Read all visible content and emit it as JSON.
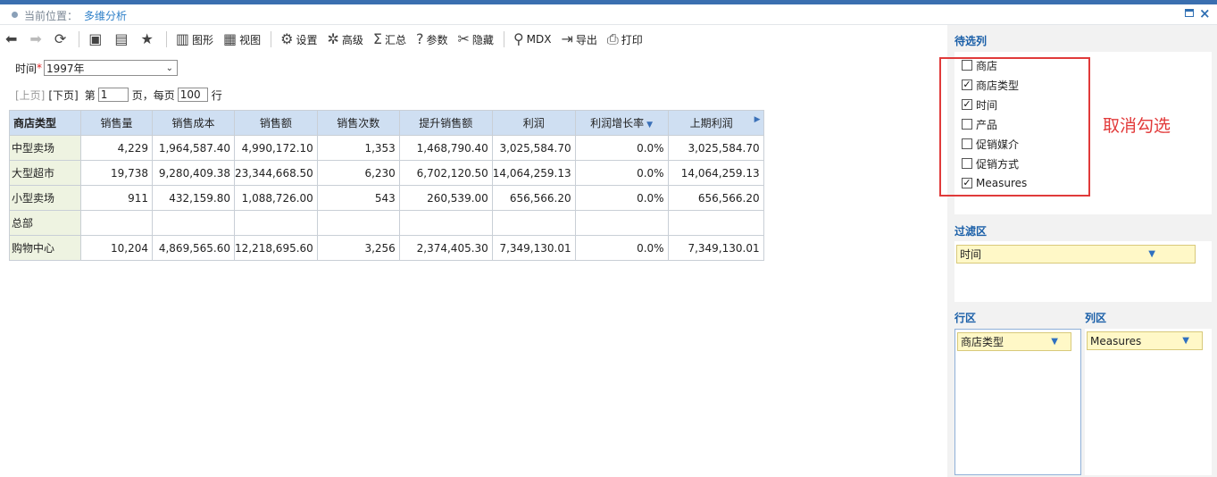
{
  "breadcrumb": {
    "label": "当前位置：",
    "current": "多维分析"
  },
  "toolbar": {
    "back": "",
    "forward": "",
    "refresh": "",
    "chart": "图形",
    "view": "视图",
    "settings": "设置",
    "advanced": "高级",
    "summary": "汇总",
    "params": "参数",
    "hide": "隐藏",
    "mdx": "MDX",
    "export": "导出",
    "print": "打印"
  },
  "filter": {
    "label": "时间",
    "required_mark": "*",
    "value": "1997年"
  },
  "pager": {
    "prev": "[上页]",
    "next": "[下页]",
    "page_prefix": "第",
    "page_value": "1",
    "page_suffix": "页，每页",
    "size_value": "100",
    "size_suffix": "行"
  },
  "table": {
    "headers": [
      "商店类型",
      "销售量",
      "销售成本",
      "销售额",
      "销售次数",
      "提升销售额",
      "利润",
      "利润增长率",
      "上期利润"
    ],
    "rows": [
      [
        "中型卖场",
        "4,229",
        "1,964,587.40",
        "4,990,172.10",
        "1,353",
        "1,468,790.40",
        "3,025,584.70",
        "0.0%",
        "3,025,584.70"
      ],
      [
        "大型超市",
        "19,738",
        "9,280,409.38",
        "23,344,668.50",
        "6,230",
        "6,702,120.50",
        "14,064,259.13",
        "0.0%",
        "14,064,259.13"
      ],
      [
        "小型卖场",
        "911",
        "432,159.80",
        "1,088,726.00",
        "543",
        "260,539.00",
        "656,566.20",
        "0.0%",
        "656,566.20"
      ],
      [
        "总部",
        "",
        "",
        "",
        "",
        "",
        "",
        "",
        ""
      ],
      [
        "购物中心",
        "10,204",
        "4,869,565.60",
        "12,218,695.60",
        "3,256",
        "2,374,405.30",
        "7,349,130.01",
        "0.0%",
        "7,349,130.01"
      ]
    ]
  },
  "candidates": {
    "title": "待选列",
    "items": [
      {
        "label": "商店",
        "checked": false
      },
      {
        "label": "商店类型",
        "checked": true
      },
      {
        "label": "时间",
        "checked": true
      },
      {
        "label": "产品",
        "checked": false
      },
      {
        "label": "促销媒介",
        "checked": false
      },
      {
        "label": "促销方式",
        "checked": false
      },
      {
        "label": "Measures",
        "checked": true
      }
    ],
    "annotation": "取消勾选"
  },
  "filter_area": {
    "title": "过滤区",
    "chip": "时间"
  },
  "row_area": {
    "title": "行区",
    "chip": "商店类型"
  },
  "col_area": {
    "title": "列区",
    "chip": "Measures"
  },
  "colors": {
    "accent": "#3a6fb0",
    "header_bg": "#cfdff2",
    "rowhead_bg": "#eef3e1",
    "chip_bg": "#fff8c7",
    "annotation": "#e23a3a"
  }
}
